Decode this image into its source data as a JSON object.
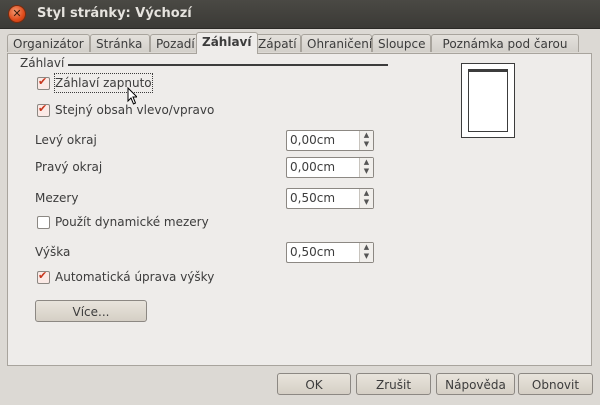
{
  "window": {
    "title": "Styl stránky: Výchozí"
  },
  "tabs": [
    {
      "label": "Organizátor",
      "active": false
    },
    {
      "label": "Stránka",
      "active": false
    },
    {
      "label": "Pozadí",
      "active": false
    },
    {
      "label": "Záhlaví",
      "active": true
    },
    {
      "label": "Zápatí",
      "active": false
    },
    {
      "label": "Ohraničení",
      "active": false
    },
    {
      "label": "Sloupce",
      "active": false
    },
    {
      "label": "Poznámka pod čarou",
      "active": false
    }
  ],
  "section": {
    "label": "Záhlaví"
  },
  "options": {
    "header_on": {
      "label": "Záhlaví zapnuto",
      "checked": true
    },
    "same_content": {
      "label": "Stejný obsah vlevo/vpravo",
      "checked": true
    },
    "dynamic_spacing": {
      "label": "Použít dynamické mezery",
      "checked": false
    },
    "autofit_height": {
      "label": "Automatická úprava výšky",
      "checked": true
    }
  },
  "fields": {
    "left_margin": {
      "label": "Levý okraj",
      "value": "0,00cm"
    },
    "right_margin": {
      "label": "Pravý okraj",
      "value": "0,00cm"
    },
    "spacing": {
      "label": "Mezery",
      "value": "0,50cm"
    },
    "height": {
      "label": "Výška",
      "value": "0,50cm"
    }
  },
  "more_button": {
    "label": "Více..."
  },
  "footer_buttons": {
    "ok": "OK",
    "cancel": "Zrušit",
    "help": "Nápověda",
    "reset": "Obnovit"
  }
}
